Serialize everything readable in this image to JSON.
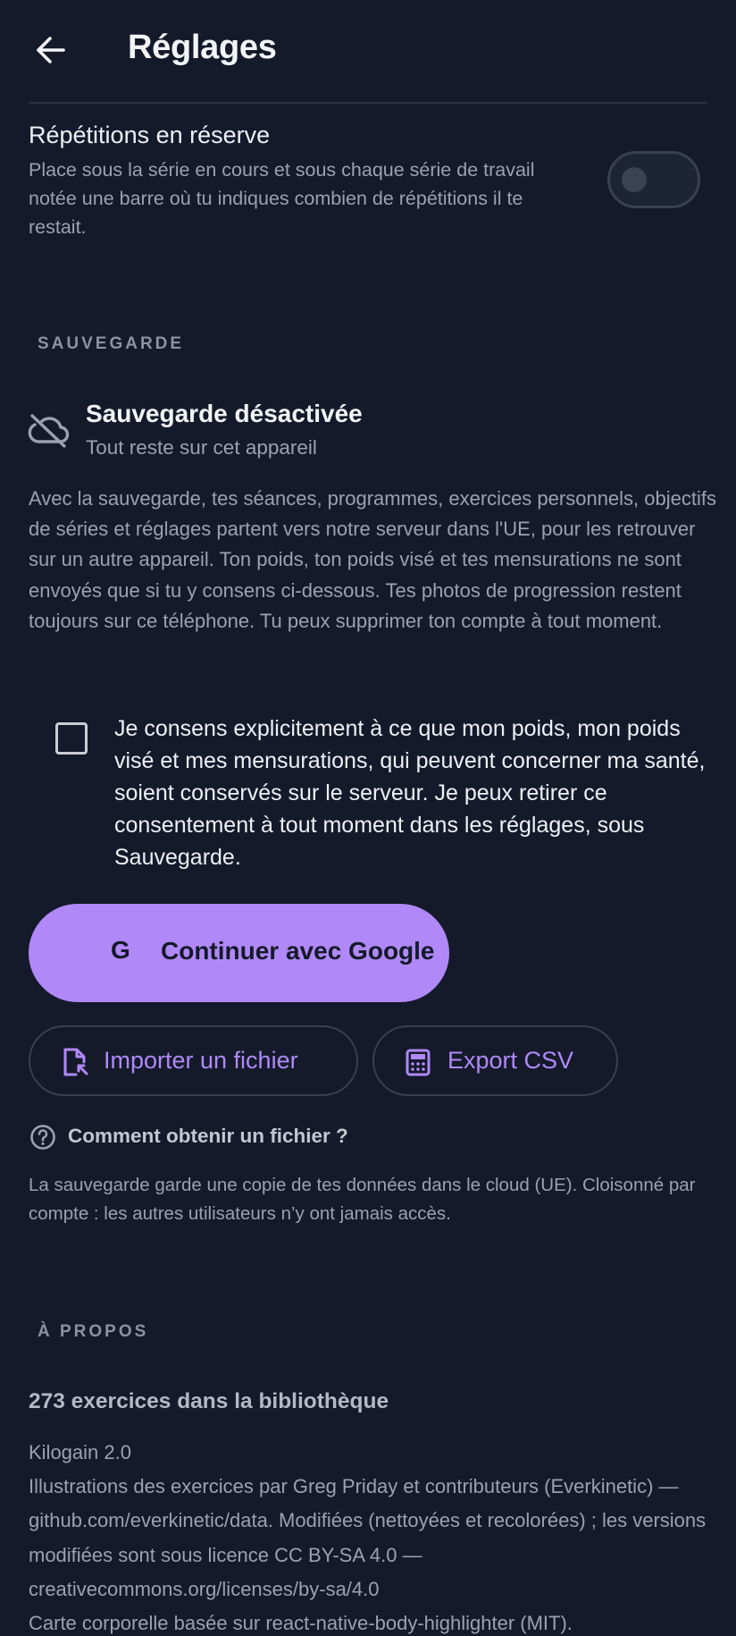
{
  "header": {
    "title": "Réglages",
    "back_icon": "arrow-left-icon"
  },
  "reserve_reps": {
    "title": "Répétitions en réserve",
    "description": "Place sous la série en cours et sous chaque série de travail notée une barre où tu indiques combien de répétitions il te restait.",
    "enabled": false
  },
  "backup": {
    "section_title": "SAUVEGARDE",
    "status_icon": "cloud-off-icon",
    "status_title": "Sauvegarde désactivée",
    "status_subtitle": "Tout reste sur cet appareil",
    "description": "Avec la sauvegarde, tes séances, programmes, exercices personnels, objectifs de séries et réglages partent vers notre serveur dans l'UE, pour les retrouver sur un autre appareil. Ton poids, ton poids visé et tes mensurations ne sont envoyés que si tu y consens ci-dessous. Tes photos de progression restent toujours sur ce téléphone. Tu peux supprimer ton compte à tout moment.",
    "consent_checked": false,
    "consent_text": "Je consens explicitement à ce que mon poids, mon poids visé et mes mensurations, qui peuvent concerner ma santé, soient conservés sur le serveur. Je peux retirer ce consentement à tout moment dans les réglages, sous Sauvegarde.",
    "google_button_glyph": "G",
    "google_button_label": "Continuer avec Google",
    "import_label": "Importer un fichier",
    "import_icon": "file-import-icon",
    "export_label": "Export CSV",
    "export_icon": "spreadsheet-icon",
    "help_icon": "question-circle-icon",
    "help_label": "Comment obtenir un fichier ?",
    "cloud_note": "La sauvegarde garde une copie de tes données dans le cloud (UE). Cloisonné par compte : les autres utilisateurs n’y ont jamais accès."
  },
  "about": {
    "section_title": "À PROPOS",
    "library_count": "273 exercices dans la bibliothèque",
    "version": "Kilogain 2.0",
    "credits": "Illustrations des exercices par Greg Priday et contributeurs (Everkinetic) — github.com/everkinetic/data. Modifiées (nettoyées et recolorées)  ; les versions modifiées sont sous licence CC BY-SA 4.0 — creativecommons.org/licenses/by-sa/4.0",
    "body_map_credit": "Carte corporelle basée sur react-native-body-highlighter (MIT)."
  },
  "colors": {
    "background": "#141a2a",
    "accent": "#b088f8",
    "muted_text": "#9aa1b1"
  }
}
